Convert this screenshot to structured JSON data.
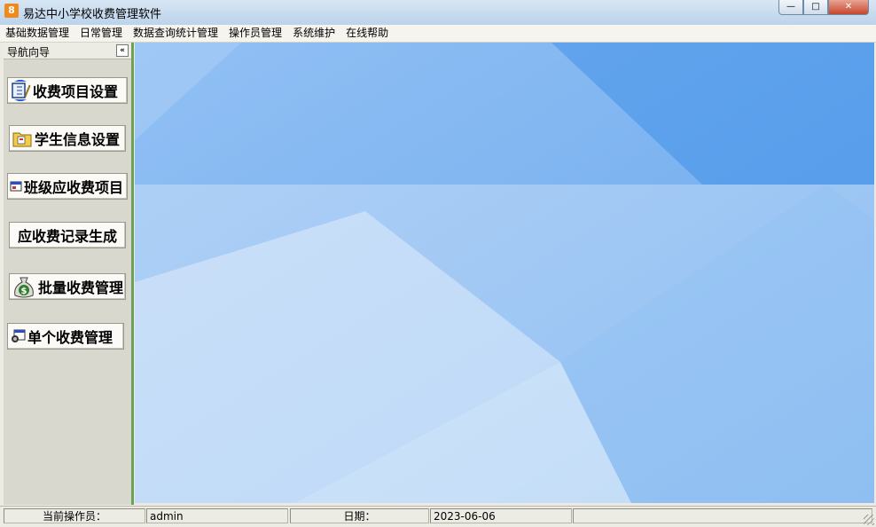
{
  "window": {
    "icon_glyph": "8",
    "title": "易达中小学校收费管理软件",
    "minimize_glyph": "—",
    "maximize_glyph": "□",
    "close_glyph": "✕"
  },
  "menu": [
    {
      "label": "基础数据管理"
    },
    {
      "label": "日常管理"
    },
    {
      "label": "数据查询统计管理"
    },
    {
      "label": "操作员管理"
    },
    {
      "label": "系统维护"
    },
    {
      "label": "在线帮助"
    }
  ],
  "nav": {
    "title": "导航向导",
    "collapse_glyph": "«",
    "buttons": [
      {
        "label": "收费项目设置",
        "icon": "fee-item-settings-icon"
      },
      {
        "label": "学生信息设置",
        "icon": "student-folder-icon"
      },
      {
        "label": "班级应收费项目",
        "icon": "class-fee-window-icon"
      },
      {
        "label": "应收费记录生成",
        "icon": ""
      },
      {
        "label": "批量收费管理",
        "icon": "money-bag-icon"
      },
      {
        "label": "单个收费管理",
        "icon": "single-fee-icon"
      }
    ]
  },
  "status": {
    "operator_label": "当前操作员：",
    "operator_value": "admin",
    "date_label": "日期：",
    "date_value": "2023-06-06"
  },
  "colors": {
    "nav_border": "#6aa356",
    "main_gradient_top": "#7bb2ee",
    "main_gradient_bottom": "#dbeafb"
  }
}
